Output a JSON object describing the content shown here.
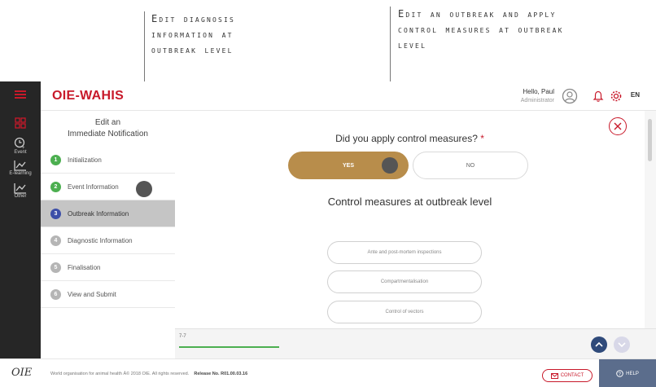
{
  "annotations": {
    "diagnosis": "Edit diagnosis\ninformation at\noutbreak level",
    "outbreak": "Edit an outbreak and apply\ncontrol measures at outbreak\nlevel"
  },
  "header": {
    "app_name": "OIE-WAHIS",
    "greeting": "Hello, Paul",
    "role": "Administrator",
    "lang": "EN"
  },
  "rail": {
    "event_label": "Event",
    "e_learning_label": "E-learning",
    "other_label": "Other"
  },
  "sidebar": {
    "title": "Edit an\nImmediate Notification",
    "steps": [
      {
        "num": "1",
        "label": "Initialization"
      },
      {
        "num": "2",
        "label": "Event Information"
      },
      {
        "num": "3",
        "label": "Outbreak Information"
      },
      {
        "num": "4",
        "label": "Diagnostic Information"
      },
      {
        "num": "5",
        "label": "Finalisation"
      },
      {
        "num": "6",
        "label": "View and Submit"
      }
    ]
  },
  "form": {
    "question": "Did you apply control measures?",
    "required_mark": "*",
    "yes_label": "YES",
    "no_label": "NO",
    "section_title": "Control measures at outbreak level",
    "measures": [
      "Ante and post-mortem inspections",
      "Compartmentalisation",
      "Control of vectors"
    ]
  },
  "pager": {
    "count": "7-7",
    "progress": 1.0
  },
  "footer": {
    "logo": "OIE",
    "copyright": "World organisation for animal health Â© 2018 OIE. All rights reserved.",
    "release": "Release No. R01.00.03.16",
    "contact_label": "CONTACT",
    "help_label": "HELP"
  },
  "colors": {
    "brand_red": "#c8192a",
    "gold": "#b88d4b",
    "step_done": "#4caf50",
    "step_current": "#3d4fa8",
    "step_pending": "#b5b5b5",
    "nav_blue": "#2f4a7a"
  }
}
